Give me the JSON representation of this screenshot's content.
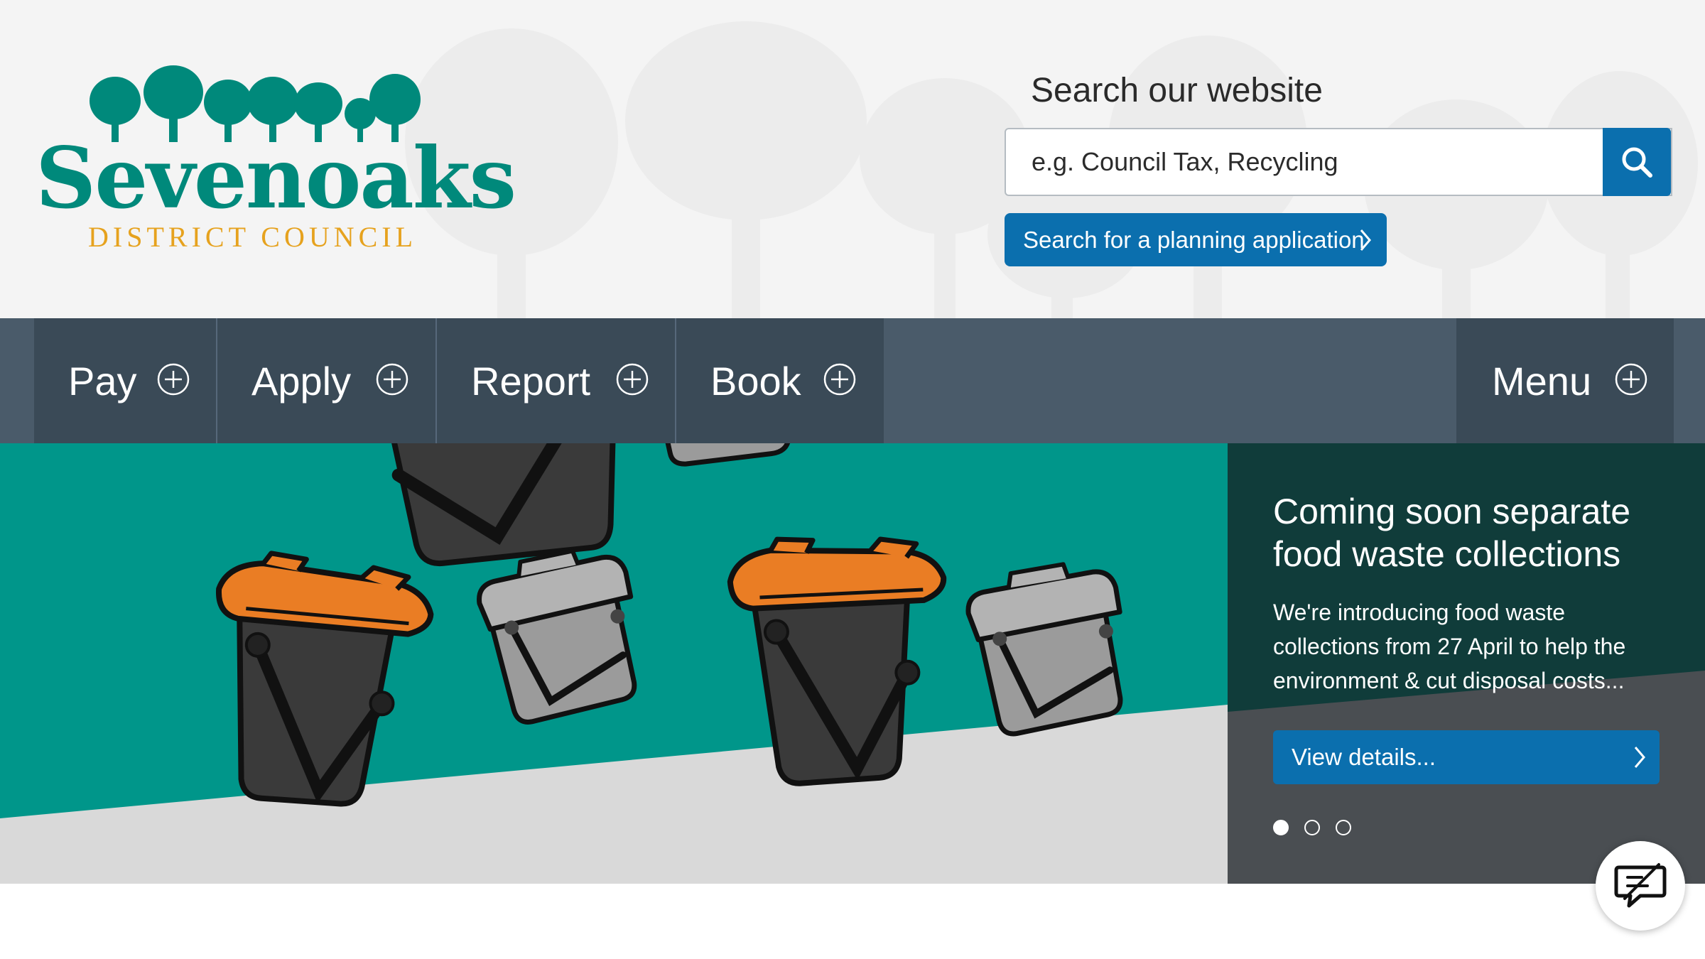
{
  "logo": {
    "name": "Sevenoaks",
    "subtitle": "DISTRICT COUNCIL"
  },
  "search": {
    "heading": "Search our website",
    "placeholder": "e.g. Council Tax, Recycling",
    "button_icon": "search-icon",
    "planning_label": "Search for a planning application"
  },
  "nav": {
    "items": [
      {
        "label": "Pay",
        "icon": "plus-circle-icon"
      },
      {
        "label": "Apply",
        "icon": "plus-circle-icon"
      },
      {
        "label": "Report",
        "icon": "plus-circle-icon"
      },
      {
        "label": "Book",
        "icon": "plus-circle-icon"
      }
    ],
    "menu": {
      "label": "Menu",
      "icon": "plus-circle-icon"
    }
  },
  "hero": {
    "title": "Coming soon separate food waste collections",
    "body": "We're introducing food waste collections from 27 April to help the environment & cut disposal costs...",
    "button_label": "View details...",
    "slides": 3,
    "active_slide": 1
  },
  "chat": {
    "icon": "chat-icon"
  },
  "colors": {
    "brand_green": "#00897b",
    "brand_gold": "#e6a21e",
    "primary_blue": "#0b6fae",
    "nav_dark": "#3a4a57",
    "nav_bg": "#4a5b6a",
    "hero_teal": "#00968a",
    "caddy_orange": "#ea7d24"
  }
}
